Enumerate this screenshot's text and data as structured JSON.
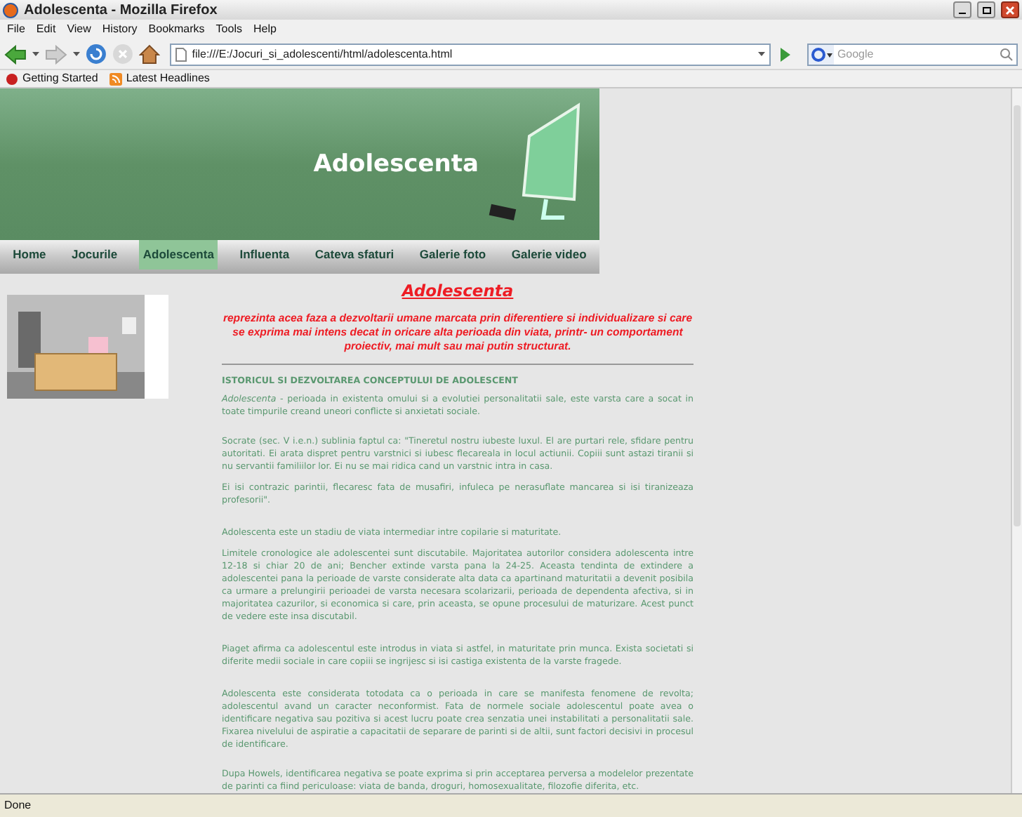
{
  "window": {
    "title": "Adolescenta - Mozilla Firefox"
  },
  "menu": [
    "File",
    "Edit",
    "View",
    "History",
    "Bookmarks",
    "Tools",
    "Help"
  ],
  "toolbar": {
    "url": "file:///E:/Jocuri_si_adolescenti/html/adolescenta.html",
    "search": {
      "placeholder": "Google"
    }
  },
  "bookmarks": [
    "Getting Started",
    "Latest Headlines"
  ],
  "banner": {
    "title": "Adolescenta"
  },
  "nav": [
    {
      "label": "Home",
      "selected": false
    },
    {
      "label": "Jocurile",
      "selected": false
    },
    {
      "label": "Adolescenta",
      "selected": true
    },
    {
      "label": "Influenta",
      "selected": false
    },
    {
      "label": "Cateva sfaturi",
      "selected": false
    },
    {
      "label": "Galerie foto",
      "selected": false
    },
    {
      "label": "Galerie video",
      "selected": false
    }
  ],
  "article": {
    "title": "Adolescenta",
    "intro": "reprezinta acea faza a dezvoltarii umane marcata prin diferentiere si individualizare si care se exprima mai intens decat in oricare alta perioada din viata, printr- un comportament proiectiv, mai mult sau mai putin structurat.",
    "section": "ISTORICUL SI DEZVOLTAREA CONCEPTULUI DE ADOLESCENT",
    "paragraphs": [
      "*Adolescenta* - perioada in existenta omului si a evolutiei personalitatii sale, este varsta care a socat in toate timpurile creand uneori conflicte si anxietati sociale.",
      "Socrate (sec. V i.e.n.) sublinia faptul ca: \"Tineretul nostru iubeste luxul. El are purtari rele, sfidare pentru autoritati. Ei arata dispret pentru varstnici si iubesc flecareala in locul actiunii. Copiii sunt astazi tiranii si nu servantii familiilor lor. Ei nu se mai ridica cand un varstnic intra in casa.",
      "Ei isi contrazic parintii, flecaresc fata de musafiri, infuleca pe nerasuflate mancarea si isi tiranizeaza profesorii\".",
      "Adolescenta este un stadiu de viata intermediar intre copilarie si maturitate.",
      "Limitele cronologice ale adolescentei sunt discutabile. Majoritatea autorilor considera adolescenta intre 12-18 si chiar 20 de ani; Bencher extinde varsta pana la 24-25. Aceasta tendinta de extindere a adolescentei pana la perioade de varste considerate alta data ca apartinand maturitatii a devenit posibila ca urmare a prelungirii perioadei de varsta necesara scolarizarii, perioada de dependenta afectiva, si in majoritatea cazurilor, si economica si care, prin aceasta, se opune procesului de maturizare. Acest punct de vedere este insa discutabil.",
      "Piaget afirma ca adolescentul este introdus in viata si astfel, in maturitate prin munca. Exista societati si diferite medii sociale in care copiii se ingrijesc si isi castiga existenta de la varste fragede.",
      "Adolescenta este considerata totodata ca o perioada in care se manifesta fenomene de revolta; adolescentul avand un caracter neconformist. Fata de normele sociale adolescentul poate avea o identificare negativa sau pozitiva si acest lucru poate crea senzatia unei instabilitati a personalitatii sale. Fixarea nivelului de aspiratie a capacitatii de separare de parinti si de altii, sunt factori decisivi in procesul de identificare.",
      "Dupa Howels, identificarea negativa se poate exprima si prin acceptarea perversa a modelelor prezentate de parinti ca fiind periculoase: viata de banda, droguri, homosexualitate, filozofie diferita, etc."
    ]
  },
  "status_bar": {
    "text": "Done"
  }
}
